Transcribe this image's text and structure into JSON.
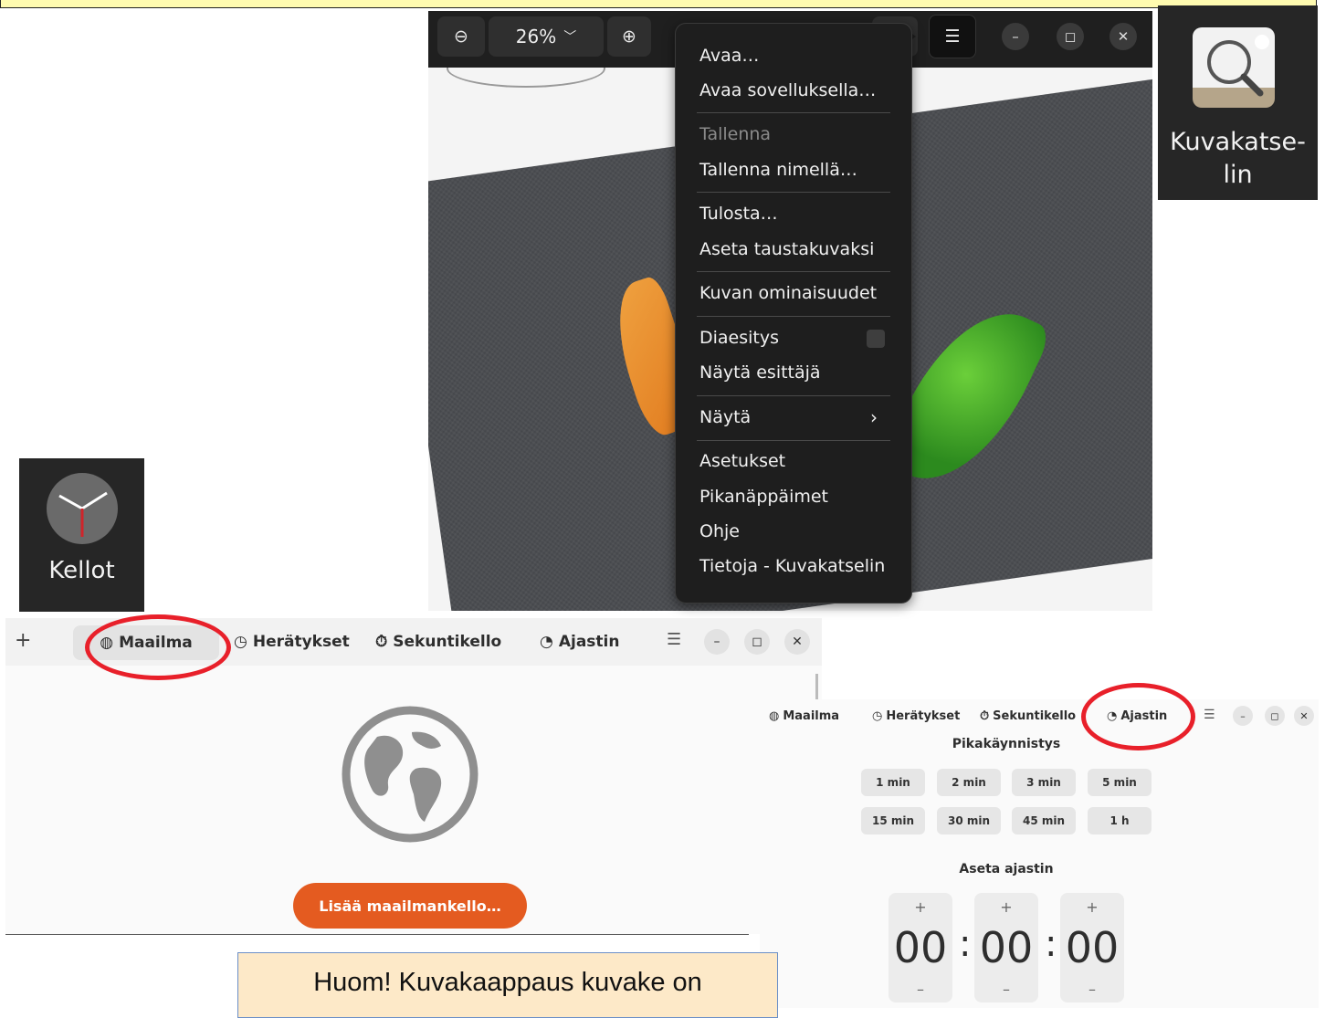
{
  "viewer": {
    "zoom_label": "26%",
    "menu_items": {
      "open": "Avaa…",
      "open_with": "Avaa sovelluksella…",
      "save": "Tallenna",
      "save_as": "Tallenna nimellä…",
      "print": "Tulosta…",
      "set_background": "Aseta taustakuvaksi",
      "properties": "Kuvan ominaisuudet",
      "slideshow": "Diaesitys",
      "show_presenter": "Näytä esittäjä",
      "show": "Näytä",
      "settings": "Asetukset",
      "shortcuts": "Pikanäppäimet",
      "help": "Ohje",
      "about": "Tietoja - Kuvakatselin"
    }
  },
  "app_tiles": {
    "image_viewer_label_1": "Kuvakatse-",
    "image_viewer_label_2": "lin",
    "clocks_label": "Kellot"
  },
  "clocks_world": {
    "tabs": [
      "Maailma",
      "Herätykset",
      "Sekuntikello",
      "Ajastin"
    ],
    "add_button": "Lisää maailmankello…"
  },
  "clocks_timer": {
    "tabs": [
      "Maailma",
      "Herätykset",
      "Sekuntikello",
      "Ajastin"
    ],
    "quick_start_title": "Pikakäynnistys",
    "quick_buttons": [
      "1 min",
      "2 min",
      "3 min",
      "5 min",
      "15 min",
      "30 min",
      "45 min",
      "1 h"
    ],
    "set_timer_title": "Aseta ajastin",
    "hours": "00",
    "minutes": "00",
    "seconds": "00"
  },
  "note": {
    "line1": "Huom! Kuvakaappaus kuvake on"
  },
  "colors": {
    "highlight_ring": "#e8202a",
    "accent_button": "#e45b20",
    "note_background": "#fde9c8"
  }
}
